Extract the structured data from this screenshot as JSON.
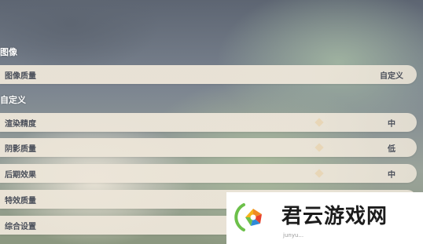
{
  "sections": [
    {
      "label": "图像"
    },
    {
      "label": "自定义"
    }
  ],
  "rows": [
    {
      "label": "图像质量",
      "value": "自定义"
    },
    {
      "label": "渲染精度",
      "value": "中"
    },
    {
      "label": "阴影质量",
      "value": "低"
    },
    {
      "label": "后期效果",
      "value": "中"
    },
    {
      "label": "特效质量",
      "value": ""
    },
    {
      "label": "综合设置",
      "value": ""
    }
  ],
  "watermark": {
    "brand": "君云游戏网",
    "url": "junyu..."
  },
  "colors": {
    "row_bg": "#ece5d8",
    "text": "#4a4f5a",
    "section_text": "#ffffff",
    "logo_orange": "#f08a24",
    "logo_red": "#e8412c",
    "logo_green": "#6cc04a",
    "logo_blue": "#2d8ad8"
  }
}
